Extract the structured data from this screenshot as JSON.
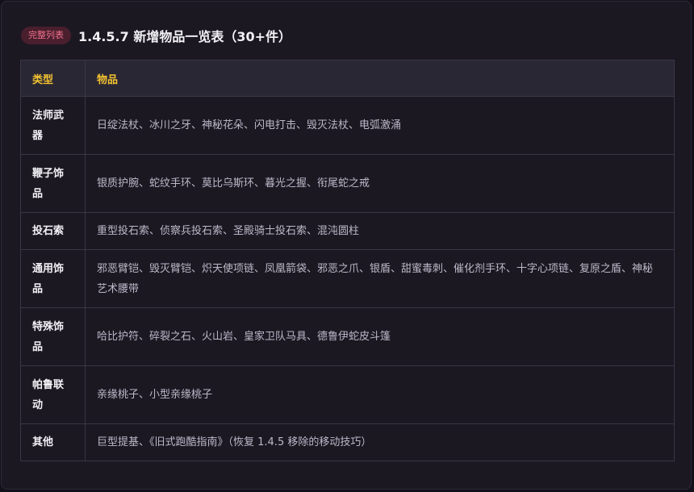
{
  "header": {
    "badge": "完整列表",
    "title": "1.4.5.7 新增物品一览表（30+件）"
  },
  "table": {
    "columns": [
      "类型",
      "物品"
    ],
    "rows": [
      {
        "type": "法师武器",
        "items": "日绽法杖、冰川之牙、神秘花朵、闪电打击、毁灭法杖、电弧激涌"
      },
      {
        "type": "鞭子饰品",
        "items": "银质护腕、蛇纹手环、莫比乌斯环、暮光之握、衔尾蛇之戒"
      },
      {
        "type": "投石索",
        "items": "重型投石索、侦察兵投石索、圣殿骑士投石索、混沌圆柱"
      },
      {
        "type": "通用饰品",
        "items": "邪恶臂铠、毁灭臂铠、炽天使项链、凤凰箭袋、邪恶之爪、银盾、甜蜜毒刺、催化剂手环、十字心项链、复原之盾、神秘艺术腰带"
      },
      {
        "type": "特殊饰品",
        "items": "哈比护符、碎裂之石、火山岩、皇家卫队马具、德鲁伊蛇皮斗篷"
      },
      {
        "type": "帕鲁联动",
        "items": "亲缘桃子、小型亲缘桃子"
      },
      {
        "type": "其他",
        "items": "巨型提基、《旧式跑酷指南》（恢复 1.4.5 移除的移动技巧）"
      }
    ]
  }
}
